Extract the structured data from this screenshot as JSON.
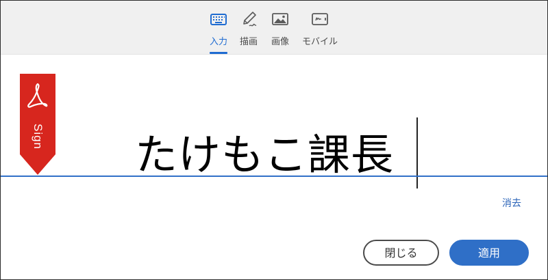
{
  "toolbar": {
    "tabs": [
      {
        "label": "入力",
        "icon": "keyboard-icon",
        "active": true
      },
      {
        "label": "描画",
        "icon": "pen-draw-icon",
        "active": false
      },
      {
        "label": "画像",
        "icon": "image-icon",
        "active": false
      },
      {
        "label": "モバイル",
        "icon": "mobile-icon",
        "active": false
      }
    ]
  },
  "sign_badge": {
    "label": "Sign",
    "icon": "acrobat-logo-icon"
  },
  "signature": {
    "text": "たけもこ課長"
  },
  "actions": {
    "clear_label": "消去",
    "close_label": "閉じる",
    "apply_label": "適用"
  },
  "colors": {
    "accent": "#2f6fc7",
    "flag": "#d7261e",
    "tab_active": "#1e6bd1"
  }
}
